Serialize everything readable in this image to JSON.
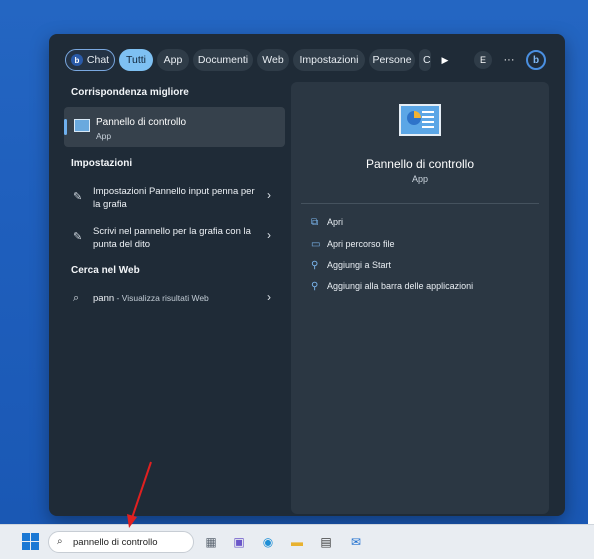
{
  "filters": {
    "chat": "Chat",
    "tabs": [
      "Tutti",
      "App",
      "Documenti",
      "Web",
      "Impostazioni",
      "Persone"
    ],
    "active": "Tutti",
    "truncated": "C",
    "play_icon": "▶",
    "user_initial": "E",
    "more_icon": "···",
    "copilot_letter": "b"
  },
  "left": {
    "best_match_heading": "Corrispondenza migliore",
    "best_match": {
      "title": "Pannello di controllo",
      "subtitle": "App",
      "icon": "control-panel-icon"
    },
    "settings_heading": "Impostazioni",
    "settings_items": [
      {
        "label": "Impostazioni Pannello input penna per la grafia",
        "icon": "pen-icon"
      },
      {
        "label": "Scrivi nel pannello per la grafia con la punta del dito",
        "icon": "pen-icon"
      }
    ],
    "web_heading": "Cerca nel Web",
    "web_item": {
      "query": "pann",
      "hint": " - Visualizza risultati Web",
      "icon": "search-icon"
    }
  },
  "right": {
    "title": "Pannello di controllo",
    "subtitle": "App",
    "actions": [
      {
        "label": "Apri",
        "icon": "open-icon"
      },
      {
        "label": "Apri percorso file",
        "icon": "folder-icon"
      },
      {
        "label": "Aggiungi a Start",
        "icon": "pin-icon"
      },
      {
        "label": "Aggiungi alla barra delle applicazioni",
        "icon": "pin-icon"
      }
    ]
  },
  "taskbar": {
    "search_value": "pannello di controllo",
    "apps": [
      "file-manager-icon",
      "video-chat-icon",
      "edge-icon",
      "explorer-folder-icon",
      "store-icon",
      "mail-icon"
    ]
  },
  "colors": {
    "menu_bg": "#1f2b37",
    "accent": "#7ec0f2",
    "desktop": "#1f5fbd",
    "arrow": "#e02020"
  }
}
